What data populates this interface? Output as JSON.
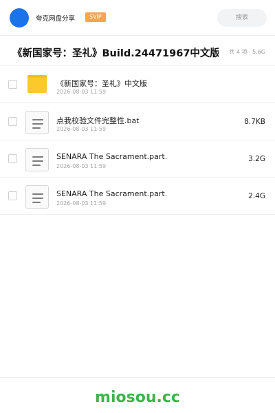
{
  "header": {
    "app_name": "夸克网盘分享",
    "badge": "SVIP",
    "search_label": "搜索",
    "avatar_color": "#1a73e8"
  },
  "folder": {
    "title": "《新国家号：圣礼》Build.24471967中文版",
    "summary": "共 4 项 · 5.6G"
  },
  "files": [
    {
      "name": "《新国家号：圣礼》中文版",
      "date": "2026-08-03 11:59",
      "size": "",
      "icon": "folder-icon"
    },
    {
      "name": "点我校验文件完整性.bat",
      "date": "2026-08-03 11:59",
      "size": "8.7KB",
      "icon": "document-icon"
    },
    {
      "name": "SENARA The Sacrament.part…",
      "date": "2026-08-03 11:59",
      "size": "3.2G",
      "icon": "document-icon"
    },
    {
      "name": "SENARA The Sacrament.part…",
      "date": "2026-08-03 11:59",
      "size": "2.4G",
      "icon": "document-icon"
    }
  ],
  "footer": {
    "brand": "miosou.cc",
    "brand_color": "#3ab54a"
  }
}
